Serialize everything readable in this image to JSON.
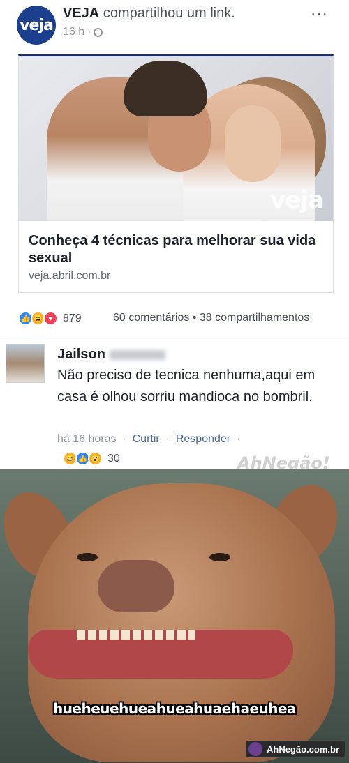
{
  "post": {
    "page_name": "VEJA",
    "action_text": "compartilhou um link.",
    "avatar_text": "veja",
    "time": "16 h",
    "more": "···"
  },
  "link_card": {
    "image_watermark": "veja",
    "title": "Conheça 4 técnicas para melhorar sua vida sexual",
    "domain": "veja.abril.com.br"
  },
  "reactions": {
    "count": "879",
    "summary": "60 comentários • 38 compartilhamentos"
  },
  "comment": {
    "author": "Jailson",
    "text": "Não preciso de tecnica nenhuma,aqui em casa é olhou sorriu mandioca no bombril.",
    "time": "há 16 horas",
    "like": "Curtir",
    "reply": "Responder",
    "reaction_count": "30"
  },
  "meme": {
    "caption": "hueheuehueahueahuaehaeuhea",
    "watermark_top": "AhNegão!",
    "watermark_footer": "AhNegão.com.br"
  }
}
